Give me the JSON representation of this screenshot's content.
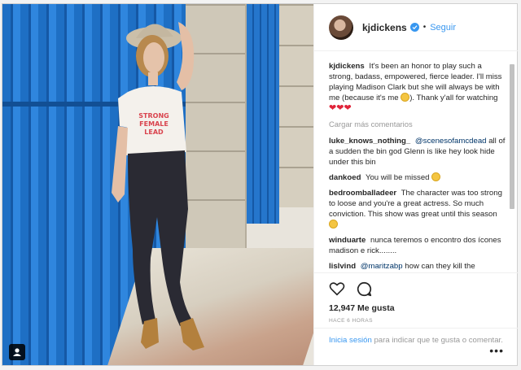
{
  "post": {
    "username": "kjdickens",
    "follow_label": "Seguir",
    "separator": "•",
    "caption": {
      "user": "kjdickens",
      "text": "It's been an honor to play such a strong, badass, empowered, fierce leader. I'll miss playing Madison Clark but she will always be with me (because it's me",
      "text_end": "). Thank y'all for watching"
    },
    "shirt_text": "STRONG FEMALE LEAD",
    "load_more": "Cargar más comentarios",
    "comments": [
      {
        "user": "luke_knows_nothing_",
        "mention": "@scenesofamcdead",
        "text": "all of a sudden the bin god Glenn is like hey look hide under this bin"
      },
      {
        "user": "dankoed",
        "text": "You will be missed"
      },
      {
        "user": "bedroomballadeer",
        "text": "The character was too strong to loose and you're a great actress. So much conviction. This show was great until this season"
      },
      {
        "user": "winduarte",
        "text": "nunca teremos o encontro dos ícones madison e rick........"
      },
      {
        "user": "lislvind",
        "mention": "@maritzabp",
        "text": "how can they kill the"
      }
    ],
    "likes": "12,947 Me gusta",
    "time": "HACE 6 HORAS",
    "login_prompt": {
      "link": "Inicia sesión",
      "text": "para indicar que te gusta o comentar."
    },
    "more_label": "•••"
  },
  "colors": {
    "accent": "#3897f0",
    "heart": "#e0243a",
    "shutter_blue": "#1e6fc4"
  },
  "icons": [
    "user-tag-icon",
    "verified-icon",
    "heart-outline-icon",
    "comment-icon",
    "more-options-icon"
  ]
}
